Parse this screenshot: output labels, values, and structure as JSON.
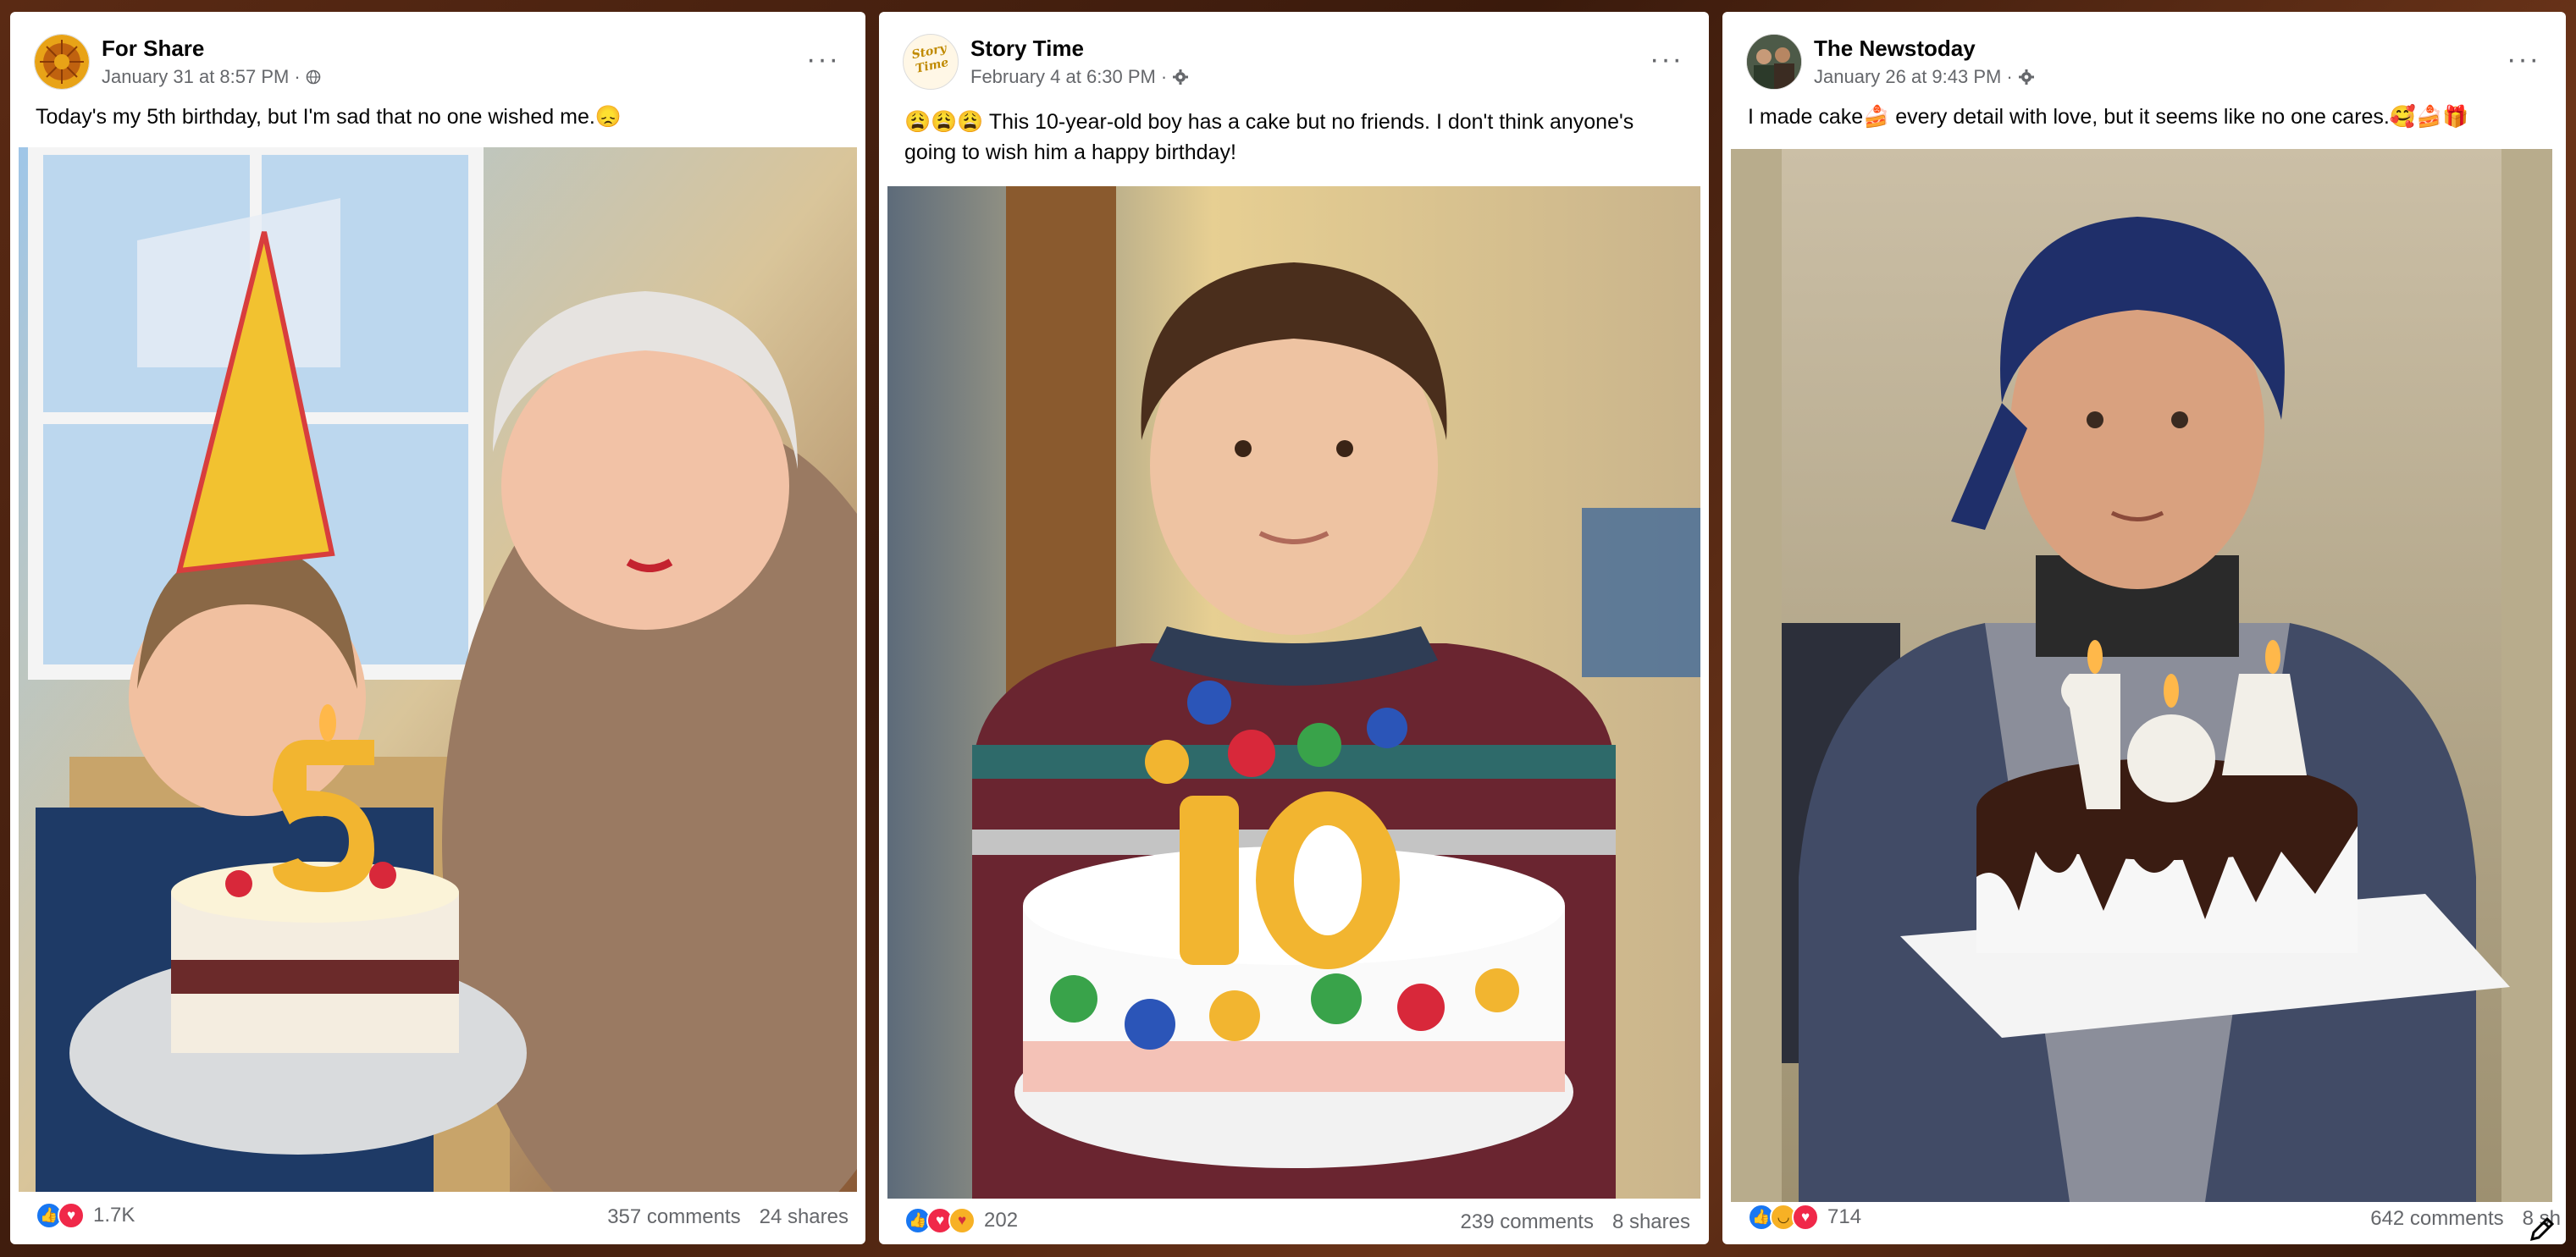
{
  "posts": [
    {
      "author": "For Share",
      "timestamp": "January 31 at 8:57 PM",
      "audience_icon": "globe-icon",
      "caption": "Today's my 5th birthday, but I'm sad that no one wished me.😞",
      "photo_candle": "5",
      "reactions": [
        "like",
        "love"
      ],
      "reaction_count": "1.7K",
      "comments": "357 comments",
      "shares": "24 shares"
    },
    {
      "author": "Story Time",
      "avatar_text": "Story Time",
      "timestamp": "February 4 at 6:30 PM",
      "audience_icon": "gear-icon",
      "caption": "😩😩😩 This 10-year-old boy has a cake but no friends. I don't think anyone's going to wish him a happy birthday!",
      "photo_candle": "10",
      "reactions": [
        "like",
        "love",
        "care"
      ],
      "reaction_count": "202",
      "comments": "239 comments",
      "shares": "8 shares"
    },
    {
      "author": "The Newstoday",
      "timestamp": "January 26 at 9:43 PM",
      "audience_icon": "gear-icon",
      "caption": "I made cake🍰 every detail with love, but it seems like no one cares.🥰🍰🎁",
      "photo_candle": "104",
      "reactions": [
        "like",
        "haha",
        "love"
      ],
      "reaction_count": "714",
      "comments": "642 comments",
      "shares": "8 sh"
    }
  ],
  "ui": {
    "more_glyph": "···",
    "dot": "·"
  },
  "colors": {
    "like": "#1877f2",
    "love": "#f02849",
    "haha": "#f7b125",
    "meta": "#65676b"
  }
}
